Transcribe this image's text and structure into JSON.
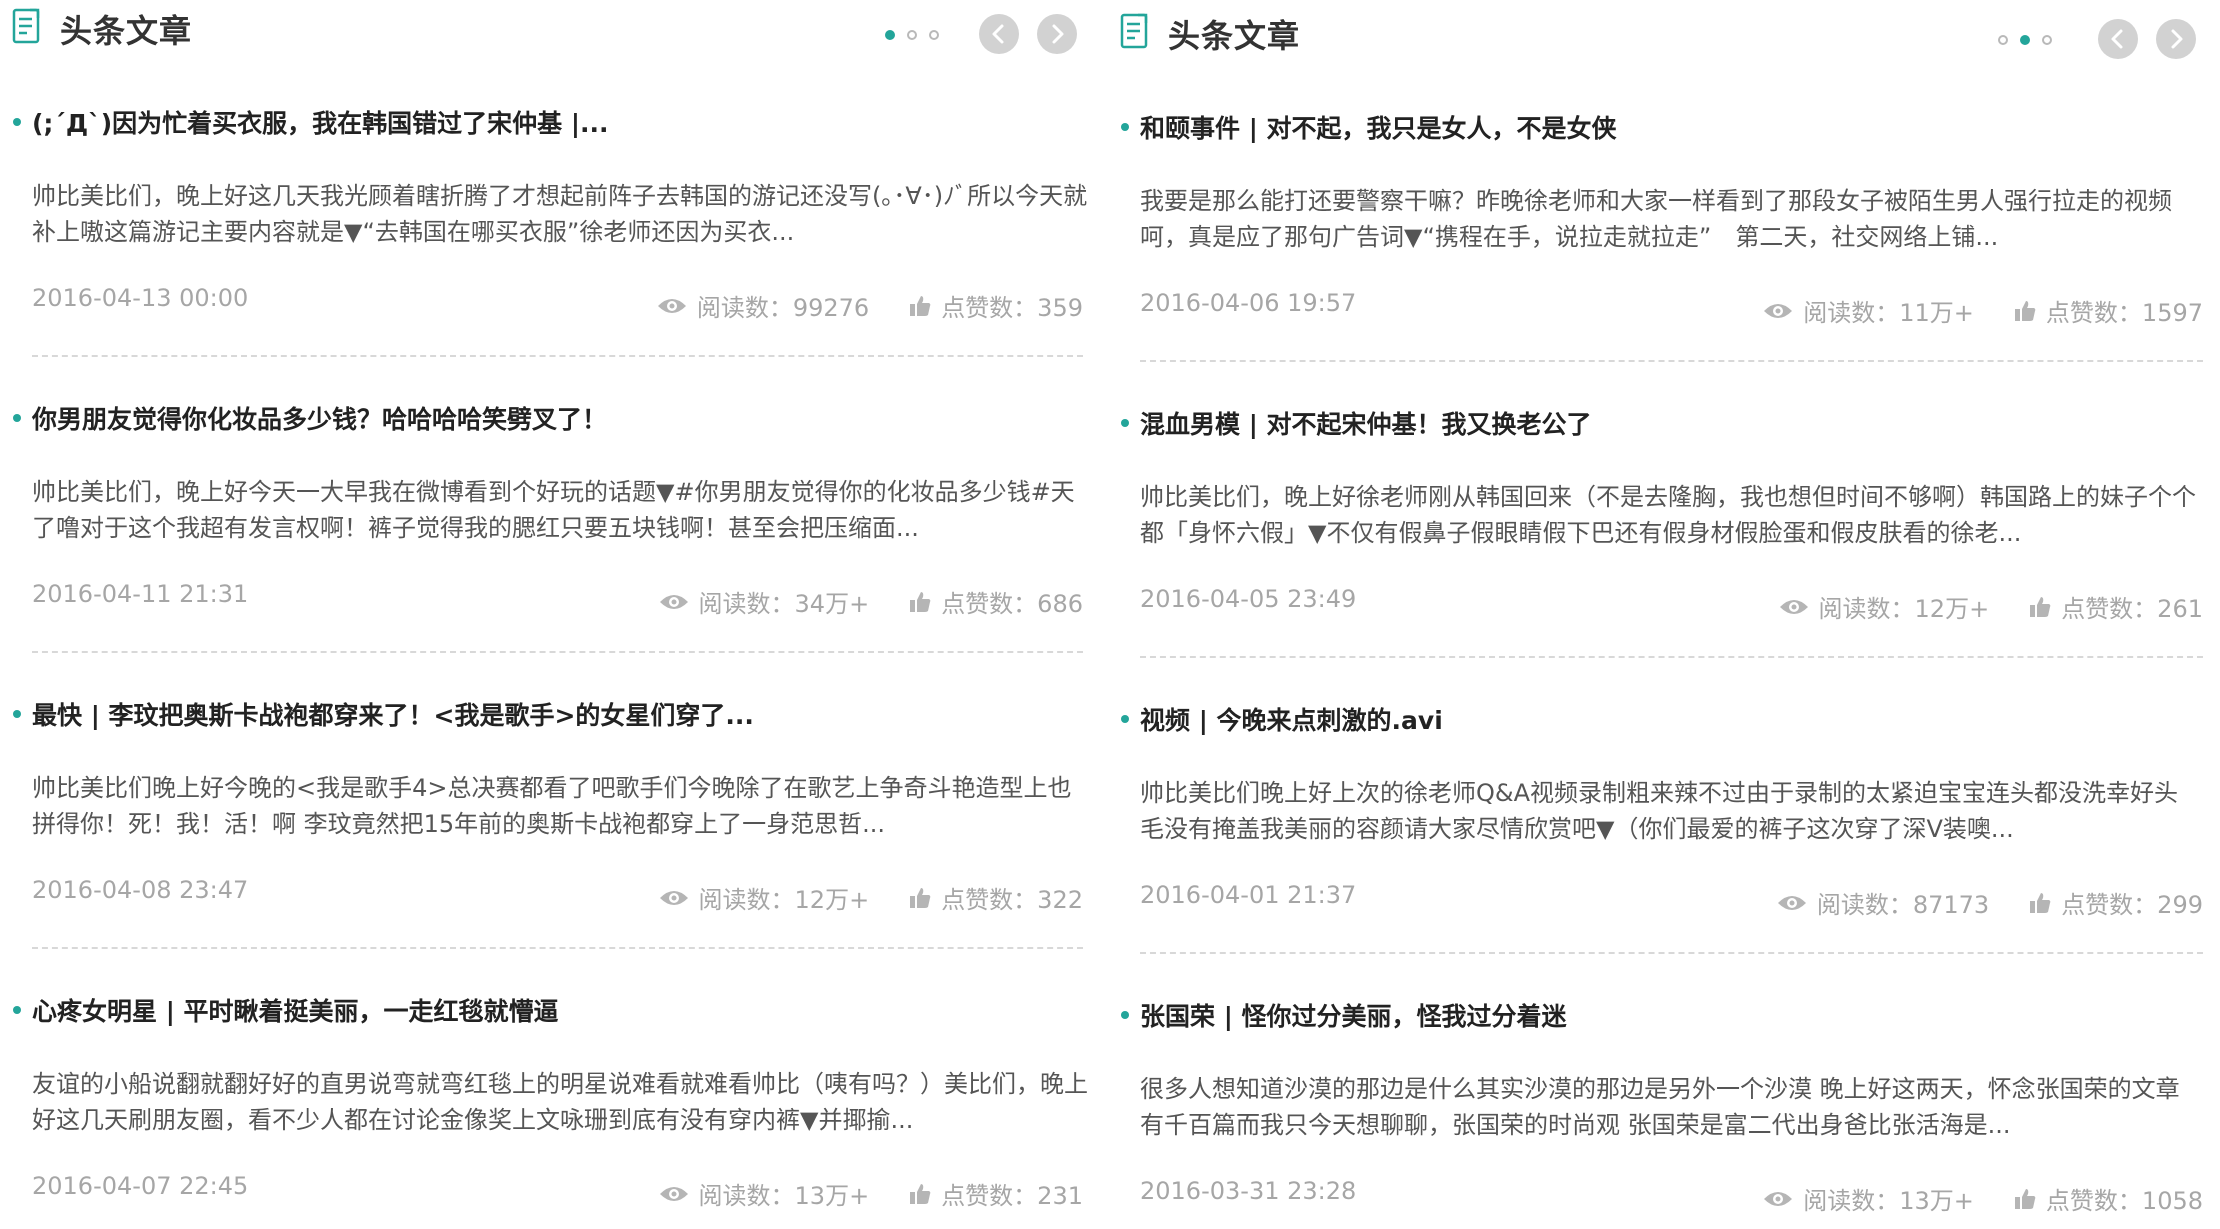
{
  "colors": {
    "accent": "#23a59a",
    "muted": "#a6a6a6",
    "nav": "#d2d2d2"
  },
  "icons": {
    "title": "article-icon",
    "read": "eye-icon",
    "like": "thumbs-up-icon",
    "prev": "chevron-left-icon",
    "next": "chevron-right-icon"
  },
  "panels": [
    {
      "title": "头条文章",
      "pager": {
        "count": 3,
        "active": 1
      },
      "articles": [
        {
          "title": "(;´Д`)因为忙着买衣服，我在韩国错过了宋仲基 |...",
          "summary": "帅比美比们，晚上好这几天我光顾着瞎折腾了才想起前阵子去韩国的游记还没写(｡･∀･)ﾉﾞ所以今天就补上嗷这篇游记主要内容就是▼“去韩国在哪买衣服”徐老师还因为买衣...",
          "date": "2016-04-13 00:00",
          "reads": "阅读数：99276",
          "likes": "点赞数：359"
        },
        {
          "title": "你男朋友觉得你化妆品多少钱？哈哈哈哈笑劈叉了！",
          "summary": "帅比美比们，晚上好今天一大早我在微博看到个好玩的话题▼#你男朋友觉得你的化妆品多少钱#天了噜对于这个我超有发言权啊！裤子觉得我的腮红只要五块钱啊！甚至会把压缩面...",
          "date": "2016-04-11 21:31",
          "reads": "阅读数：34万+",
          "likes": "点赞数：686"
        },
        {
          "title": "最快 | 李玟把奥斯卡战袍都穿来了！<我是歌手>的女星们穿了...",
          "summary": "帅比美比们晚上好今晚的<我是歌手4>总决赛都看了吧歌手们今晚除了在歌艺上争奇斗艳造型上也拼得你！死！我！活！啊 李玟竟然把15年前的奥斯卡战袍都穿上了一身范思哲...",
          "date": "2016-04-08 23:47",
          "reads": "阅读数：12万+",
          "likes": "点赞数：322"
        },
        {
          "title": "心疼女明星 | 平时瞅着挺美丽，一走红毯就懵逼",
          "summary": "友谊的小船说翻就翻好好的直男说弯就弯红毯上的明星说难看就难看帅比（咦有吗？）美比们，晚上好这几天刷朋友圈，看不少人都在讨论金像奖上文咏珊到底有没有穿内裤▼并揶揄...",
          "date": "2016-04-07 22:45",
          "reads": "阅读数：13万+",
          "likes": "点赞数：231"
        }
      ]
    },
    {
      "title": "头条文章",
      "pager": {
        "count": 3,
        "active": 2
      },
      "articles": [
        {
          "title": "和颐事件 | 对不起，我只是女人，不是女侠",
          "summary": "我要是那么能打还要警察干嘛？昨晚徐老师和大家一样看到了那段女子被陌生男人强行拉走的视频呵，真是应了那句广告词▼“携程在手，说拉走就拉走”　第二天，社交网络上铺...",
          "date": "2016-04-06 19:57",
          "reads": "阅读数：11万+",
          "likes": "点赞数：1597"
        },
        {
          "title": "混血男模 | 对不起宋仲基！我又换老公了",
          "summary": "帅比美比们，晚上好徐老师刚从韩国回来（不是去隆胸，我也想但时间不够啊）韩国路上的妹子个个都「身怀六假」▼不仅有假鼻子假眼睛假下巴还有假身材假脸蛋和假皮肤看的徐老...",
          "date": "2016-04-05 23:49",
          "reads": "阅读数：12万+",
          "likes": "点赞数：261"
        },
        {
          "title": "视频 | 今晚来点刺激的.avi",
          "summary": "帅比美比们晚上好上次的徐老师Q&A视频录制粗来辣不过由于录制的太紧迫宝宝连头都没洗幸好头毛没有掩盖我美丽的容颜请大家尽情欣赏吧▼（你们最爱的裤子这次穿了深V装噢...",
          "date": "2016-04-01 21:37",
          "reads": "阅读数：87173",
          "likes": "点赞数：299"
        },
        {
          "title": "张国荣 | 怪你过分美丽，怪我过分着迷",
          "summary": "很多人想知道沙漠的那边是什么其实沙漠的那边是另外一个沙漠 晚上好这两天，怀念张国荣的文章有千百篇而我只今天想聊聊，张国荣的时尚观 张国荣是富二代出身爸比张活海是...",
          "date": "2016-03-31 23:28",
          "reads": "阅读数：13万+",
          "likes": "点赞数：1058"
        }
      ]
    }
  ]
}
